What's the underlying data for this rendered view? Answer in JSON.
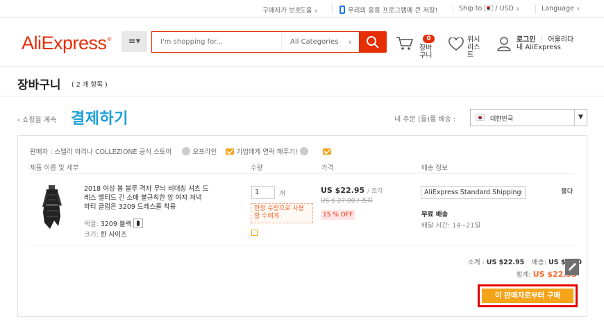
{
  "topbar": {
    "buyer_protection": "구매자가 보호",
    "help": "도움",
    "app_promo": "우리의 응용 프로그램에 큰 저장!",
    "ship_to": "Ship to",
    "currency": "/ USD",
    "language": "Language"
  },
  "header": {
    "logo": "AliExpress",
    "search_placeholder": "I'm shopping for...",
    "category": "All Categories",
    "cart_count": "0",
    "cart_label_1": "장바",
    "cart_label_2": "구니",
    "wishlist_1": "위시",
    "wishlist_2": "리스",
    "wishlist_3": "트",
    "login": "로그인",
    "join": "어울리다",
    "my_account": "내 AliExpress"
  },
  "page": {
    "title": "장바구니",
    "count": "( 2 개 항목 )",
    "continue": "‹ 쇼핑을 계속",
    "checkout": "결제하기",
    "ship_to_label": "내 주문 (들)를 배송 :",
    "ship_to_country": "대한민국"
  },
  "cart": {
    "seller": "판매자 : 스텔라 마리나 COLLEZIONE 공식 스토어",
    "offline": "오프라인",
    "contact": "기업에게 연락 해주기!",
    "col_product": "제품 이름 및 세부",
    "col_qty": "수량",
    "col_price": "가격",
    "col_shipping": "배송 정보",
    "item": {
      "name_line1": "2018 여성 봄 블루 격자 무늬 비대칭 셔츠 드",
      "name_line2": "레스 벨티드 긴 소매 불규칙한 앙 여자 저녁",
      "name_line3": "파티 클럽은 3209 드레스를 착용",
      "color_label": "색깔:",
      "color_value": "3209 블랙",
      "size_label": "크기:",
      "size_value": "한 사이즈",
      "qty": "1",
      "qty_unit": "개",
      "limited_1": "한정 수량으로 사용",
      "limited_2": "할 수에게",
      "price": "US $22.95",
      "per": "/ 조각",
      "old_price": "US $ 27.00 / 조각",
      "discount": "15 % OFF",
      "shipping_method": "AliExpress Standard Shipping",
      "free_shipping": "무료 배송",
      "eta": "배달 시간: 14~21일",
      "remove": "물다"
    },
    "subtotal_label": "소계 :",
    "subtotal": "US $22.95",
    "shipping_label": "배송:",
    "shipping": "US $0.00",
    "total_label": "합계:",
    "total": "US $22.95",
    "buy_button": "이 판매자로부터 구매"
  },
  "colors": {
    "brand": "#e62e04",
    "checkout_link": "#1a9fd8",
    "buy_button": "#f5a319"
  }
}
